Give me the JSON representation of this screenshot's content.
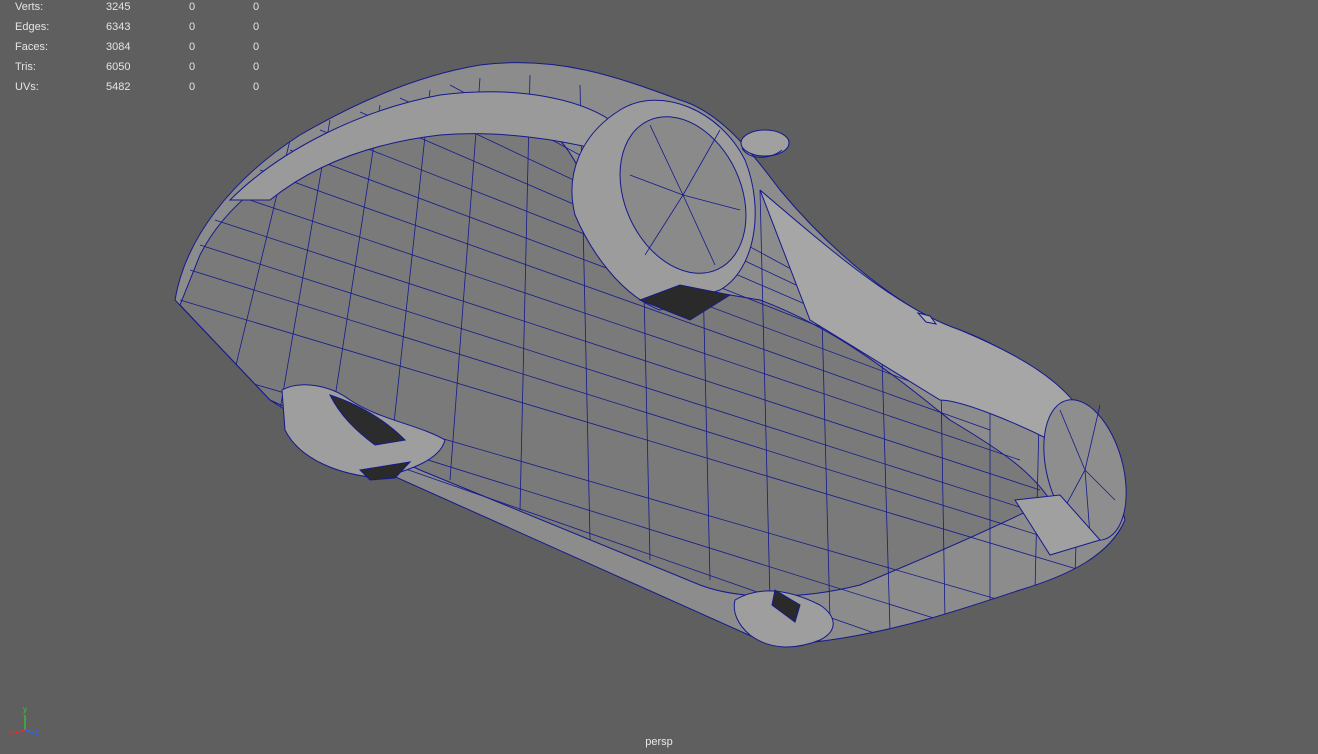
{
  "hud": {
    "rows": [
      {
        "label": "Verts:",
        "values": [
          "3245",
          "0",
          "0"
        ]
      },
      {
        "label": "Edges:",
        "values": [
          "6343",
          "0",
          "0"
        ]
      },
      {
        "label": "Faces:",
        "values": [
          "3084",
          "0",
          "0"
        ]
      },
      {
        "label": "Tris:",
        "values": [
          "6050",
          "0",
          "0"
        ]
      },
      {
        "label": "UVs:",
        "values": [
          "5482",
          "0",
          "0"
        ]
      }
    ]
  },
  "viewport": {
    "camera": "persp",
    "background_color": "#5f5f5f",
    "wireframe_color": "#141a8c",
    "surface_color": "#8f8f8f"
  },
  "axis_gizmo": {
    "x_label": "x",
    "y_label": "y",
    "z_label": "z",
    "x_color": "#e03030",
    "y_color": "#30d030",
    "z_color": "#3060ff"
  }
}
